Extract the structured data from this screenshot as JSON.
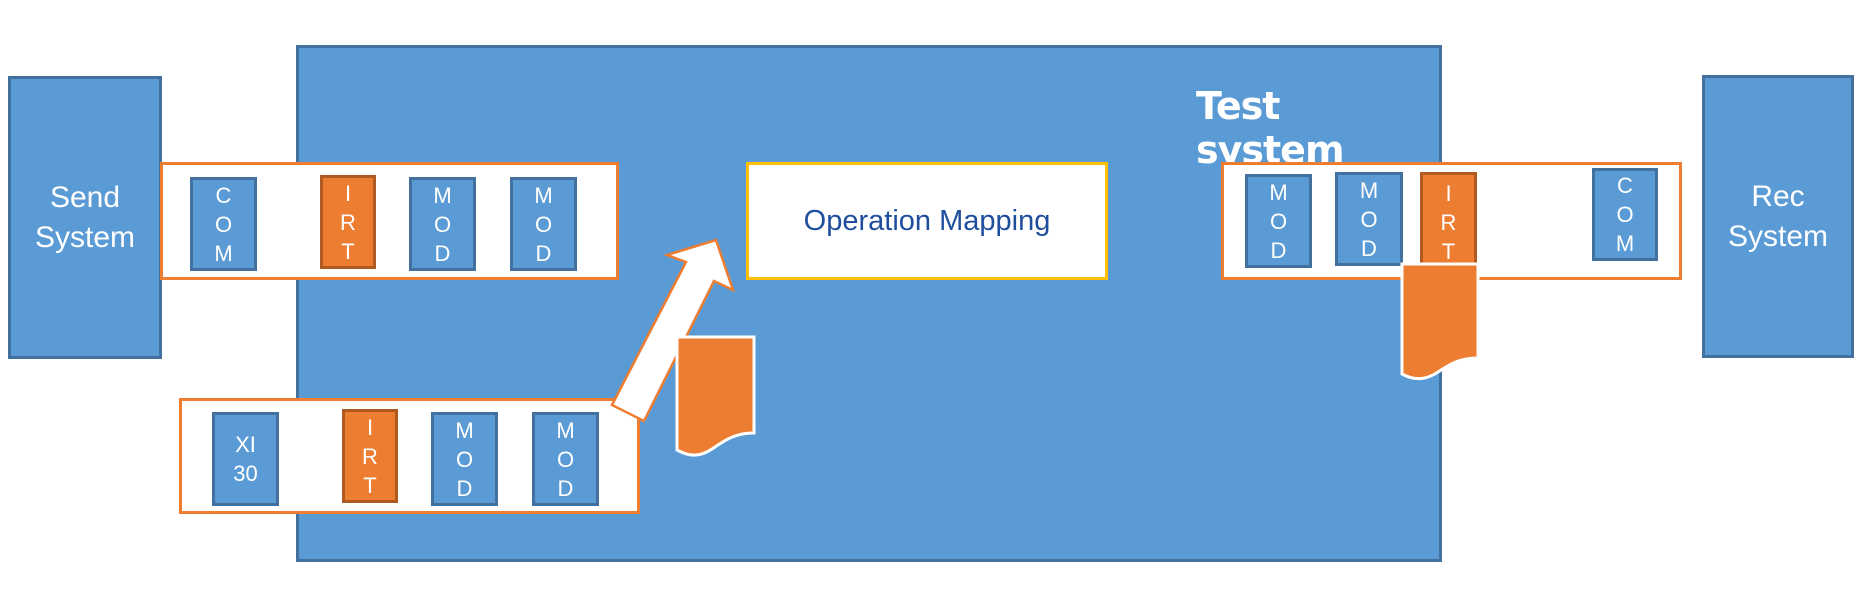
{
  "send_system": {
    "label_line1": "Send",
    "label_line2": "System"
  },
  "rec_system": {
    "label_line1": "Rec",
    "label_line2": "System"
  },
  "test_system": {
    "title": "Test system"
  },
  "operation_mapping": {
    "label": "Operation Mapping"
  },
  "sender_channel": {
    "blocks": [
      {
        "type": "com",
        "letters": [
          "C",
          "O",
          "M"
        ]
      },
      {
        "type": "irt",
        "letters": [
          "I",
          "R",
          "T"
        ]
      },
      {
        "type": "mod",
        "letters": [
          "M",
          "O",
          "D"
        ]
      },
      {
        "type": "mod",
        "letters": [
          "M",
          "O",
          "D"
        ]
      }
    ]
  },
  "xi_channel": {
    "blocks": [
      {
        "type": "xi",
        "letters": [
          "XI",
          "30"
        ]
      },
      {
        "type": "irt",
        "letters": [
          "I",
          "R",
          "T"
        ]
      },
      {
        "type": "mod",
        "letters": [
          "M",
          "O",
          "D"
        ]
      },
      {
        "type": "mod",
        "letters": [
          "M",
          "O",
          "D"
        ]
      }
    ]
  },
  "receiver_channel": {
    "blocks": [
      {
        "type": "mod",
        "letters": [
          "M",
          "O",
          "D"
        ]
      },
      {
        "type": "mod",
        "letters": [
          "M",
          "O",
          "D"
        ]
      },
      {
        "type": "irt",
        "letters": [
          "I",
          "R",
          "T"
        ]
      },
      {
        "type": "com",
        "letters": [
          "C",
          "O",
          "M"
        ]
      }
    ]
  },
  "colors": {
    "system_fill": "#5b9bd5",
    "system_border": "#41719c",
    "channel_border": "#ed7d31",
    "irt_fill": "#ed7d31",
    "mapping_border": "#ffc000",
    "mapping_text": "#1f4e9e"
  }
}
